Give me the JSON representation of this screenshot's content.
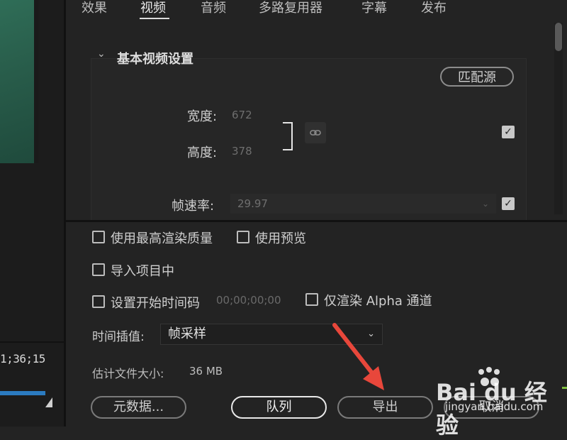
{
  "tabs": [
    {
      "label": "效果"
    },
    {
      "label": "视频"
    },
    {
      "label": "音频"
    },
    {
      "label": "多路复用器"
    },
    {
      "label": "字幕"
    },
    {
      "label": "发布"
    }
  ],
  "active_tab": "视频",
  "video_settings": {
    "section_title": "基本视频设置",
    "match_source_label": "匹配源",
    "width_label": "宽度:",
    "width_value": "672",
    "height_label": "高度:",
    "height_value": "378",
    "frame_rate_label": "帧速率:",
    "frame_rate_value": "29.97"
  },
  "options": {
    "max_render_quality": "使用最高渲染质量",
    "use_previews": "使用预览",
    "import_into_project": "导入项目中",
    "set_start_timecode": "设置开始时间码",
    "start_timecode_value": "00;00;00;00",
    "render_alpha_only": "仅渲染 Alpha 通道"
  },
  "interpolation": {
    "label": "时间插值:",
    "value": "帧采样"
  },
  "file_size": {
    "label": "估计文件大小:",
    "value": "36 MB"
  },
  "buttons": {
    "metadata": "元数据...",
    "queue": "队列",
    "export": "导出",
    "cancel": "取消"
  },
  "preview": {
    "timecode": "1;36;15"
  },
  "watermark": {
    "brand": "Bai du 经验",
    "url": "jingyan.baidu.com"
  },
  "colors": {
    "background": "#232323",
    "accent_blue": "#2b7bc0",
    "annotation_red": "#e8473b"
  }
}
